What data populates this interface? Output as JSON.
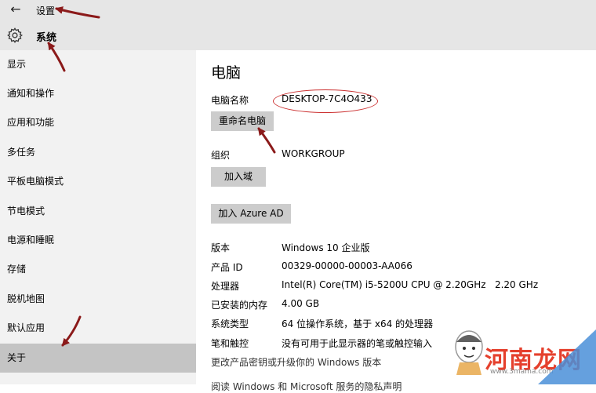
{
  "window": {
    "title": "设置"
  },
  "header": {
    "section": "系统"
  },
  "sidebar": {
    "items": [
      {
        "label": "显示"
      },
      {
        "label": "通知和操作"
      },
      {
        "label": "应用和功能"
      },
      {
        "label": "多任务"
      },
      {
        "label": "平板电脑模式"
      },
      {
        "label": "节电模式"
      },
      {
        "label": "电源和睡眠"
      },
      {
        "label": "存储"
      },
      {
        "label": "脱机地图"
      },
      {
        "label": "默认应用"
      },
      {
        "label": "关于",
        "selected": true
      }
    ]
  },
  "main": {
    "title": "电脑",
    "pc_name_label": "电脑名称",
    "pc_name_value": "DESKTOP-7C4O433",
    "rename_button": "重命名电脑",
    "org_label": "组织",
    "org_value": "WORKGROUP",
    "join_domain_button": "加入域",
    "join_azure_button": "加入 Azure AD",
    "specs": [
      {
        "label": "版本",
        "value": "Windows 10 企业版"
      },
      {
        "label": "产品 ID",
        "value": "00329-00000-00003-AA066"
      },
      {
        "label": "处理器",
        "value": "Intel(R) Core(TM) i5-5200U CPU @ 2.20GHz   2.20 GHz"
      },
      {
        "label": "已安装的内存",
        "value": "4.00 GB"
      },
      {
        "label": "系统类型",
        "value": "64 位操作系统，基于 x64 的处理器"
      },
      {
        "label": "笔和触控",
        "value": "没有可用于此显示器的笔或触控输入"
      }
    ],
    "change_key_link": "更改产品密钥或升级你的 Windows 版本",
    "privacy_link": "阅读 Windows 和 Microsoft 服务的隐私声明"
  },
  "watermark": {
    "text": "河南龙网",
    "url": "www.3mama.com"
  },
  "colors": {
    "annotation": "#8b1a1a",
    "ellipse": "#cc3333",
    "selected": "#c4c4c4",
    "sidebar": "#f2f2f2",
    "titlebar": "#e6e6e6",
    "button": "#cccccc"
  },
  "icons": {
    "back": "back-arrow-icon",
    "settings": "gear-icon"
  }
}
